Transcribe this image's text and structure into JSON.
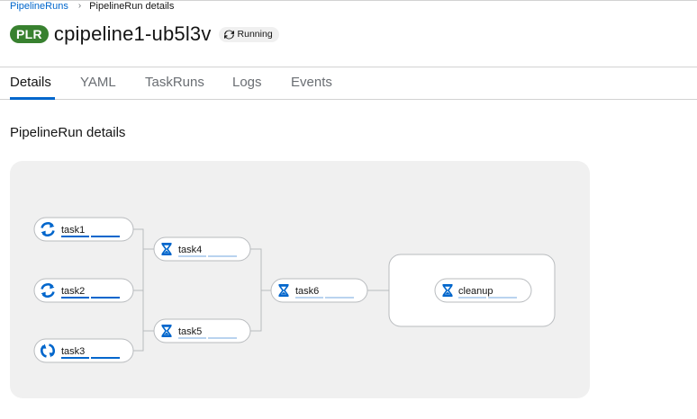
{
  "breadcrumb": {
    "parent": "PipelineRuns",
    "current": "PipelineRun details"
  },
  "header": {
    "badge": "PLR",
    "name": "cpipeline1-ub5l3v",
    "status": "Running"
  },
  "tabs": [
    {
      "label": "Details",
      "active": true
    },
    {
      "label": "YAML",
      "active": false
    },
    {
      "label": "TaskRuns",
      "active": false
    },
    {
      "label": "Logs",
      "active": false
    },
    {
      "label": "Events",
      "active": false
    }
  ],
  "section": {
    "title": "PipelineRun details"
  },
  "pipeline": {
    "tasks": [
      {
        "name": "task1",
        "state": "running",
        "icon": "sync-icon"
      },
      {
        "name": "task2",
        "state": "running",
        "icon": "sync-icon"
      },
      {
        "name": "task3",
        "state": "running",
        "icon": "sync-icon"
      },
      {
        "name": "task4",
        "state": "pending",
        "icon": "hourglass-icon"
      },
      {
        "name": "task5",
        "state": "pending",
        "icon": "hourglass-icon"
      },
      {
        "name": "task6",
        "state": "pending",
        "icon": "hourglass-icon"
      },
      {
        "name": "cleanup",
        "state": "pending",
        "icon": "hourglass-icon",
        "finally": true
      }
    ],
    "edges": [
      [
        "task1",
        "task4"
      ],
      [
        "task1",
        "task5"
      ],
      [
        "task2",
        "task4"
      ],
      [
        "task2",
        "task5"
      ],
      [
        "task3",
        "task4"
      ],
      [
        "task3",
        "task5"
      ],
      [
        "task4",
        "task6"
      ],
      [
        "task5",
        "task6"
      ],
      [
        "task6",
        "cleanup"
      ]
    ]
  },
  "colors": {
    "accent": "#0066cc",
    "badge": "#38812f",
    "running_icon": "#0066cc",
    "pending_icon": "#0066cc"
  }
}
